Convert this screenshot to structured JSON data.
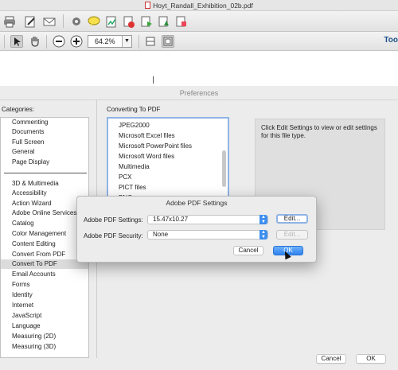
{
  "window": {
    "title": "Hoyt_Randall_Exhibition_02b.pdf"
  },
  "toolbar": {
    "zoom_value": "64.2%",
    "tools_label": "Too"
  },
  "preferences": {
    "title": "Preferences",
    "categories_label": "Categories:",
    "categories_top": [
      "Commenting",
      "Documents",
      "Full Screen",
      "General",
      "Page Display"
    ],
    "categories_bottom": [
      "3D & Multimedia",
      "Accessibility",
      "Action Wizard",
      "Adobe Online Services",
      "Catalog",
      "Color Management",
      "Content Editing",
      "Convert From PDF",
      "Convert To PDF",
      "Email Accounts",
      "Forms",
      "Identity",
      "Internet",
      "JavaScript",
      "Language",
      "Measuring (2D)",
      "Measuring (3D)"
    ],
    "selected_category": "Convert To PDF",
    "converting_label": "Converting To PDF",
    "file_types": [
      "JPEG2000",
      "Microsoft Excel files",
      "Microsoft PowerPoint files",
      "Microsoft Word files",
      "Multimedia",
      "PCX",
      "PICT files",
      "PNG"
    ],
    "info_text": "Click Edit Settings to view or edit settings for this file type.",
    "cancel_label": "Cancel",
    "ok_label": "OK"
  },
  "modal": {
    "title": "Adobe PDF Settings",
    "settings_label": "Adobe PDF Settings:",
    "settings_value": "15.47x10.27",
    "security_label": "Adobe PDF Security:",
    "security_value": "None",
    "edit_label": "Edit...",
    "cancel_label": "Cancel",
    "ok_label": "OK"
  },
  "icons": [
    "print-icon",
    "edit-icon",
    "email-icon",
    "gear-icon",
    "comment-icon",
    "sign-icon",
    "delete-page-icon",
    "export-icon",
    "share-icon",
    "stamp-icon",
    "select-icon",
    "hand-icon",
    "zoom-out-icon",
    "zoom-in-icon",
    "fit-page-icon",
    "fit-width-icon"
  ]
}
